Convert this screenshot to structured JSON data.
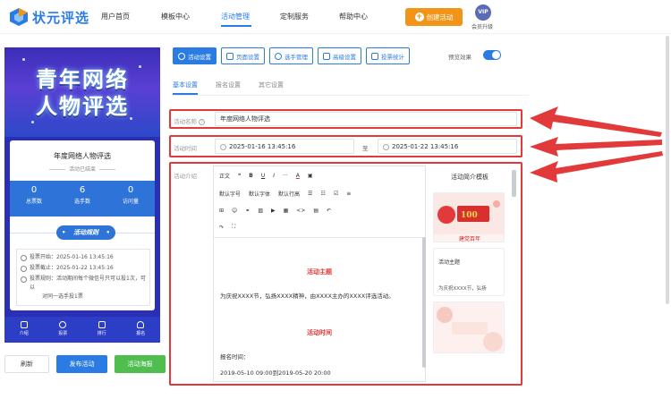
{
  "app": {
    "name": "状元评选"
  },
  "nav": {
    "items": [
      "用户首页",
      "模板中心",
      "活动管理",
      "定制服务",
      "帮助中心"
    ],
    "active_index": 2,
    "create_label": "创建活动",
    "vip_badge": "VIP",
    "vip_label": "会员升级"
  },
  "preview": {
    "hero_line1": "青年网络",
    "hero_line2": "人物评选",
    "card_title": "年度网络人物评选",
    "card_status": "活动已结束",
    "stats": [
      {
        "value": "0",
        "label": "总票数"
      },
      {
        "value": "6",
        "label": "选手数"
      },
      {
        "value": "0",
        "label": "访问量"
      }
    ],
    "rules_button": "活动规则",
    "rules": [
      "投票开始：2025-01-16 13:45:16",
      "投票截止：2025-01-22 13:45:16",
      "投票规则：活动期间每个微信号只可以投1次，可以",
      "对同一选手投1票"
    ],
    "tabs": [
      "介绍",
      "投票",
      "排行",
      "报名"
    ]
  },
  "bottom_buttons": {
    "refresh": "刷新",
    "publish": "发布活动",
    "poster": "活动海报"
  },
  "toolbar": {
    "buttons": [
      "活动设置",
      "页面设置",
      "选手管理",
      "高级设置",
      "投票统计"
    ],
    "preview_label": "预览效果",
    "preview_on": true
  },
  "subtabs": [
    "基本设置",
    "报名设置",
    "其它设置"
  ],
  "form": {
    "name_label": "活动名称",
    "name_value": "年度网络人物评选",
    "time_label": "活动时间",
    "start": "2025-01-16 13:45:16",
    "to_label": "至",
    "end": "2025-01-22 13:45:16",
    "intro_label": "活动介绍"
  },
  "editor": {
    "row1": [
      "正文",
      "❝",
      "B",
      "U",
      "I",
      "···",
      "A",
      "▣"
    ],
    "row2": [
      "默认字号",
      "默认字体",
      "默认行高",
      "☰",
      "☷",
      "☑",
      "≡"
    ],
    "row3": [
      "⊞",
      "☺",
      "⚭",
      "▨",
      "▶",
      "▦",
      "<>",
      "▤",
      "↶"
    ],
    "row4": [
      "↷",
      "⛶"
    ],
    "heading1": "活动主题",
    "para1": "为庆祝XXXX节，弘扬XXXX精神，由XXXX主办的XXXX评选活动。",
    "heading2": "活动时间",
    "para2": "报名时间：",
    "para3": "2019-05-10 09:00到2019-05-20 20:00"
  },
  "templates": {
    "title": "活动简介模板",
    "card1_text": "建党百年",
    "card2_title": "活动主题",
    "card2_body": "为庆祝XXXX节，弘扬"
  },
  "colors": {
    "accent": "#2a7be4",
    "orange": "#f29418",
    "green": "#4fbe4e",
    "red": "#e23a3a"
  }
}
